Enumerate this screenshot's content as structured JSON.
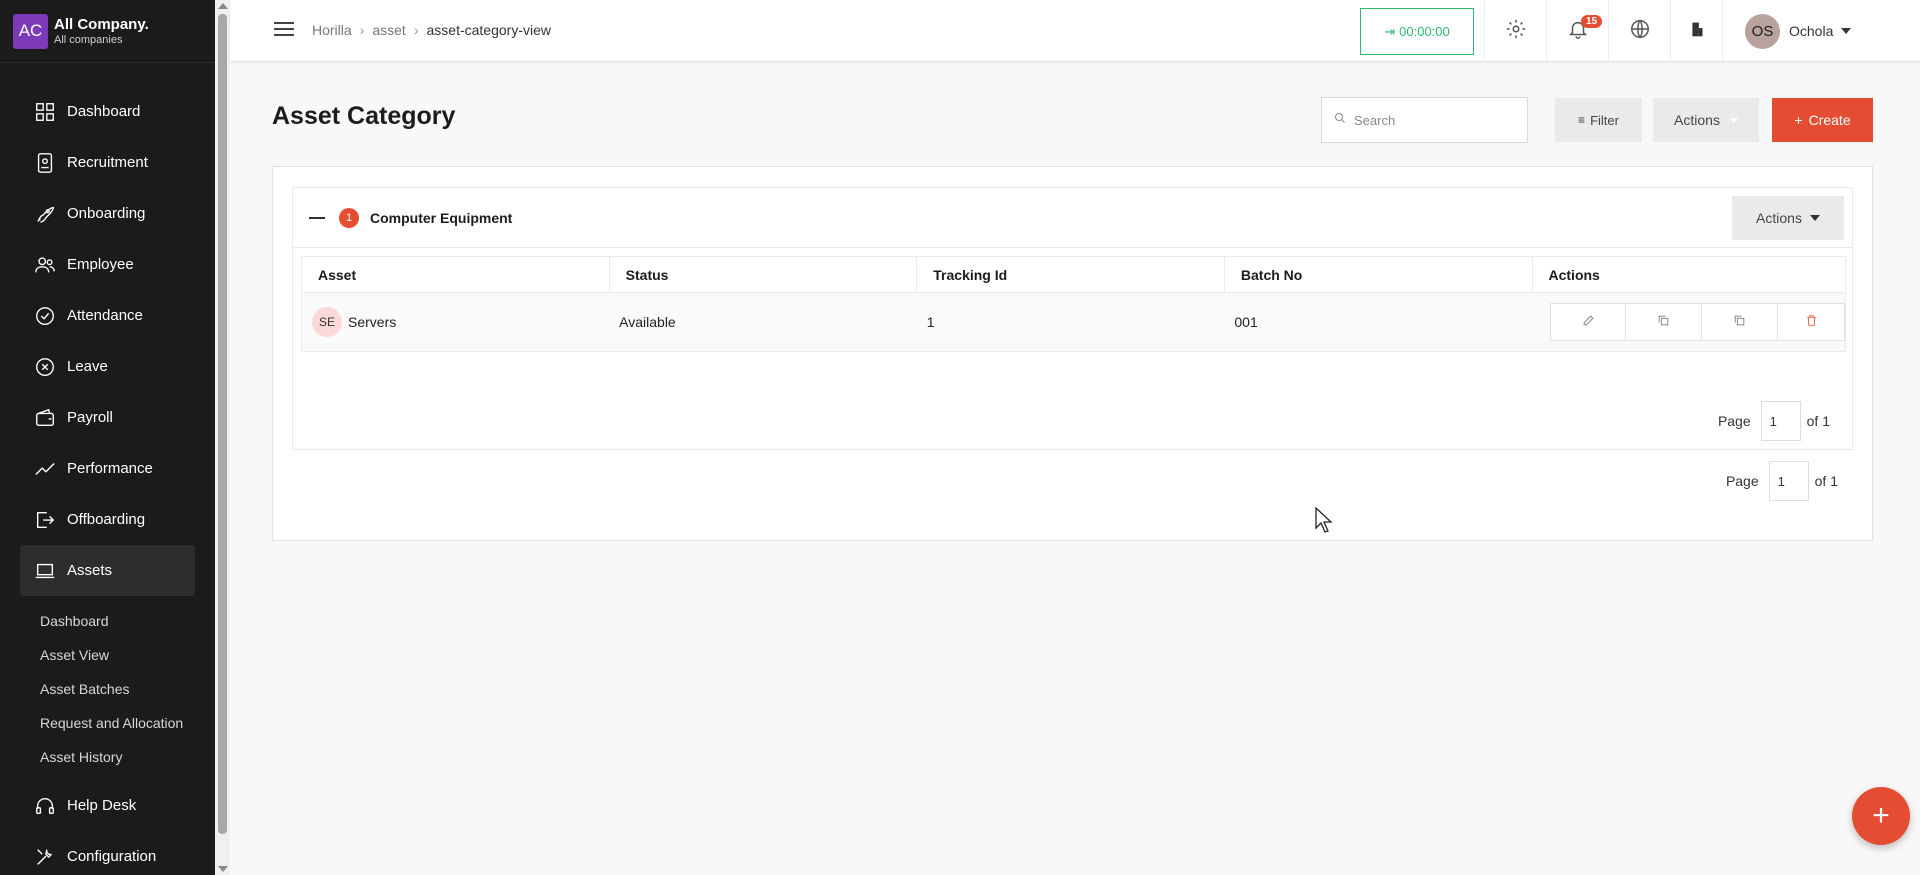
{
  "company": {
    "logo_text": "AC",
    "name": "All Company.",
    "subtitle": "All companies"
  },
  "sidebar": {
    "items": [
      {
        "label": "Dashboard",
        "icon": "grid-icon"
      },
      {
        "label": "Recruitment",
        "icon": "id-badge-icon"
      },
      {
        "label": "Onboarding",
        "icon": "rocket-icon"
      },
      {
        "label": "Employee",
        "icon": "users-icon"
      },
      {
        "label": "Attendance",
        "icon": "check-circle-icon"
      },
      {
        "label": "Leave",
        "icon": "x-circle-icon"
      },
      {
        "label": "Payroll",
        "icon": "wallet-icon"
      },
      {
        "label": "Performance",
        "icon": "trend-icon"
      },
      {
        "label": "Offboarding",
        "icon": "exit-icon"
      },
      {
        "label": "Assets",
        "icon": "laptop-icon"
      }
    ],
    "subitems": [
      "Dashboard",
      "Asset View",
      "Asset Batches",
      "Request and Allocation",
      "Asset History"
    ],
    "bottom_items": [
      {
        "label": "Help Desk",
        "icon": "headset-icon"
      },
      {
        "label": "Configuration",
        "icon": "wrench-icon"
      }
    ]
  },
  "header": {
    "breadcrumb": [
      "Horilla",
      "asset",
      "asset-category-view"
    ],
    "timer": "00:00:00",
    "notification_count": "15",
    "user": {
      "initials": "OS",
      "name": "Ochola"
    }
  },
  "page": {
    "title": "Asset Category",
    "search_placeholder": "Search",
    "filter_label": "Filter",
    "actions_label": "Actions",
    "create_label": "Create"
  },
  "group": {
    "count": "1",
    "name": "Computer Equipment",
    "actions_label": "Actions",
    "columns": [
      "Asset",
      "Status",
      "Tracking Id",
      "Batch No",
      "Actions"
    ],
    "rows": [
      {
        "initials": "SE",
        "asset": "Servers",
        "status": "Available",
        "tracking_id": "1",
        "batch_no": "001"
      }
    ],
    "pager": {
      "label": "Page",
      "value": "1",
      "of": "of 1"
    }
  },
  "outer_pager": {
    "label": "Page",
    "value": "1",
    "of": "of 1"
  },
  "colors": {
    "accent": "#e54d33",
    "timer": "#2eb872",
    "sidebar": "#1b1b1b"
  }
}
